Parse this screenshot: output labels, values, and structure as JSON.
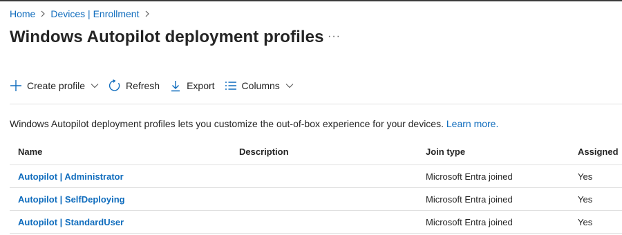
{
  "breadcrumb": {
    "home": "Home",
    "section": "Devices | Enrollment"
  },
  "page": {
    "title": "Windows Autopilot deployment profiles",
    "more_label": "···"
  },
  "toolbar": {
    "create_label": "Create profile",
    "refresh_label": "Refresh",
    "export_label": "Export",
    "columns_label": "Columns"
  },
  "description": {
    "text": "Windows Autopilot deployment profiles lets you customize the out-of-box experience for your devices.",
    "link": "Learn more."
  },
  "table": {
    "headers": [
      "Name",
      "Description",
      "Join type",
      "Assigned"
    ],
    "rows": [
      {
        "name": "Autopilot | Administrator",
        "description": "",
        "join_type": "Microsoft Entra joined",
        "assigned": "Yes"
      },
      {
        "name": "Autopilot | SelfDeploying",
        "description": "",
        "join_type": "Microsoft Entra joined",
        "assigned": "Yes"
      },
      {
        "name": "Autopilot | StandardUser",
        "description": "",
        "join_type": "Microsoft Entra joined",
        "assigned": "Yes"
      }
    ]
  },
  "colors": {
    "link": "#0f6cbd",
    "text": "#242424",
    "divider": "#e0e0e0"
  }
}
